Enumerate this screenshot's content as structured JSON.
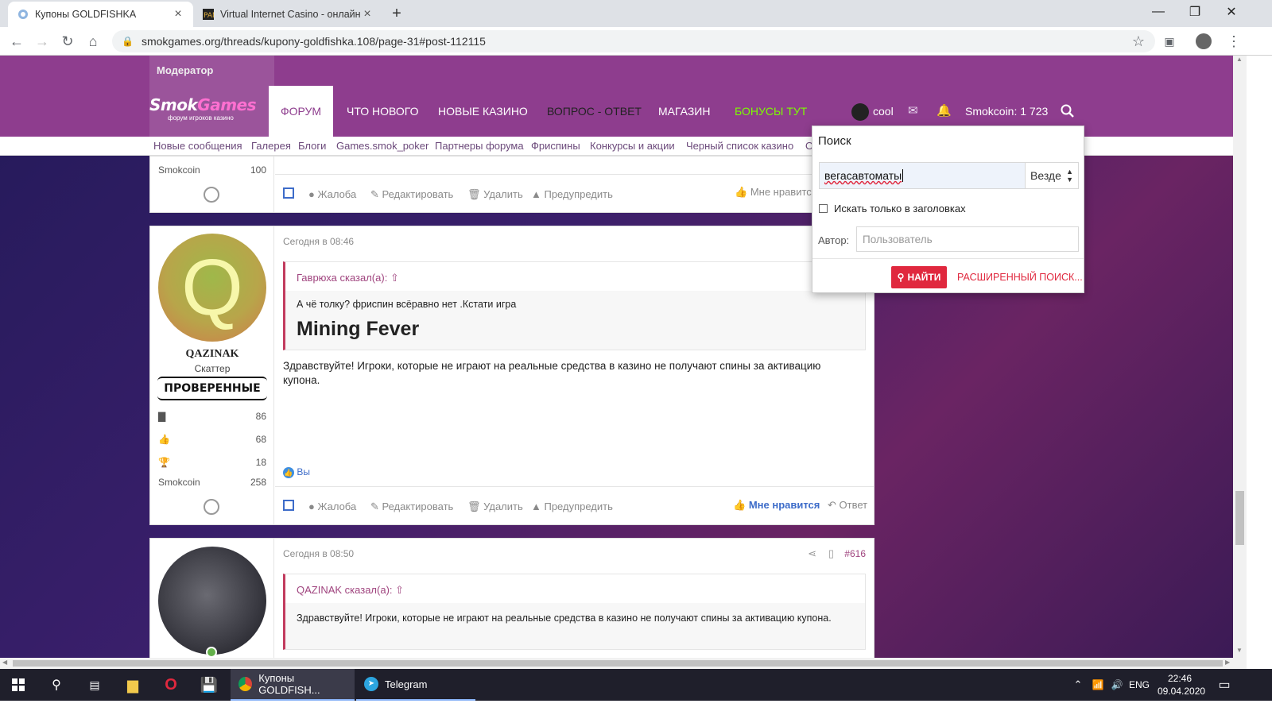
{
  "browser": {
    "tabs": [
      {
        "title": "Купоны GOLDFISHKA"
      },
      {
        "title": "Virtual Internet Casino - онлайн"
      }
    ],
    "new_tab": "+",
    "url": "smokgames.org/threads/kupony-goldfishka.108/page-31#post-112115"
  },
  "site": {
    "ghost_moderator": "Модератор",
    "logo_main": "Smok",
    "logo_accent": "Games",
    "logo_sub": "форум игроков казино",
    "nav": [
      "Форум",
      "Что нового",
      "Новые казино",
      "Вопрос - ответ",
      "Магазин",
      "Бонусы тут"
    ],
    "user": "cool",
    "smokcoin": "Smokcoin: 1 723",
    "subnav": [
      "Новые сообщения",
      "Галерея",
      "Блоги",
      "Games.smok_poker",
      "Партнеры форума",
      "Фриспины",
      "Конкурсы и акции",
      "Черный список казино",
      "О"
    ]
  },
  "post_prev": {
    "smokcoin_label": "Smokcoin",
    "smokcoin_value": "100",
    "actions": {
      "report": "Жалоба",
      "edit": "Редактировать",
      "delete": "Удалить",
      "warn": "Предупредить",
      "like": "Мне нравится"
    }
  },
  "post_main": {
    "avatar_letter": "Q",
    "username": "QAZINAK",
    "user_title": "Скаттер",
    "banner": "ПРОВЕРЕННЫЕ",
    "stats": [
      {
        "icon": "messages-icon",
        "value": "86"
      },
      {
        "icon": "thumbs-up-icon",
        "value": "68"
      },
      {
        "icon": "trophy-icon",
        "value": "18"
      }
    ],
    "smokcoin_label": "Smokcoin",
    "smokcoin_value": "258",
    "time": "Сегодня в 08:46",
    "quote_author": "Гаврюха сказал(а):",
    "quote_text": "А чё толку? фриспин всёравно нет .Кстати игра",
    "quote_big": "Mining Fever",
    "body": "Здравствуйте! Игроки, которые не играют на реальные средства в казино не получают спины за активацию купона.",
    "reaction": "Вы",
    "actions": {
      "report": "Жалоба",
      "edit": "Редактировать",
      "delete": "Удалить",
      "warn": "Предупредить",
      "like": "Мне нравится",
      "reply": "Ответ"
    }
  },
  "post_next": {
    "time": "Сегодня в 08:50",
    "number": "#616",
    "quote_author": "QAZINAK сказал(а):",
    "quote_text": "Здравствуйте! Игроки, которые не играют на реальные средства в казино не получают спины за активацию купона."
  },
  "search": {
    "title": "Поиск",
    "query": "вегасавтоматы",
    "scope": "Везде",
    "titles_only": "Искать только в заголовках",
    "author_label": "Автор:",
    "author_placeholder": "Пользователь",
    "submit": "НАЙТИ",
    "advanced": "Расширенный поиск..."
  },
  "taskbar": {
    "chrome_task": "Купоны GOLDFISH...",
    "telegram_task": "Telegram",
    "lang": "ENG",
    "time": "22:46",
    "date": "09.04.2020"
  }
}
